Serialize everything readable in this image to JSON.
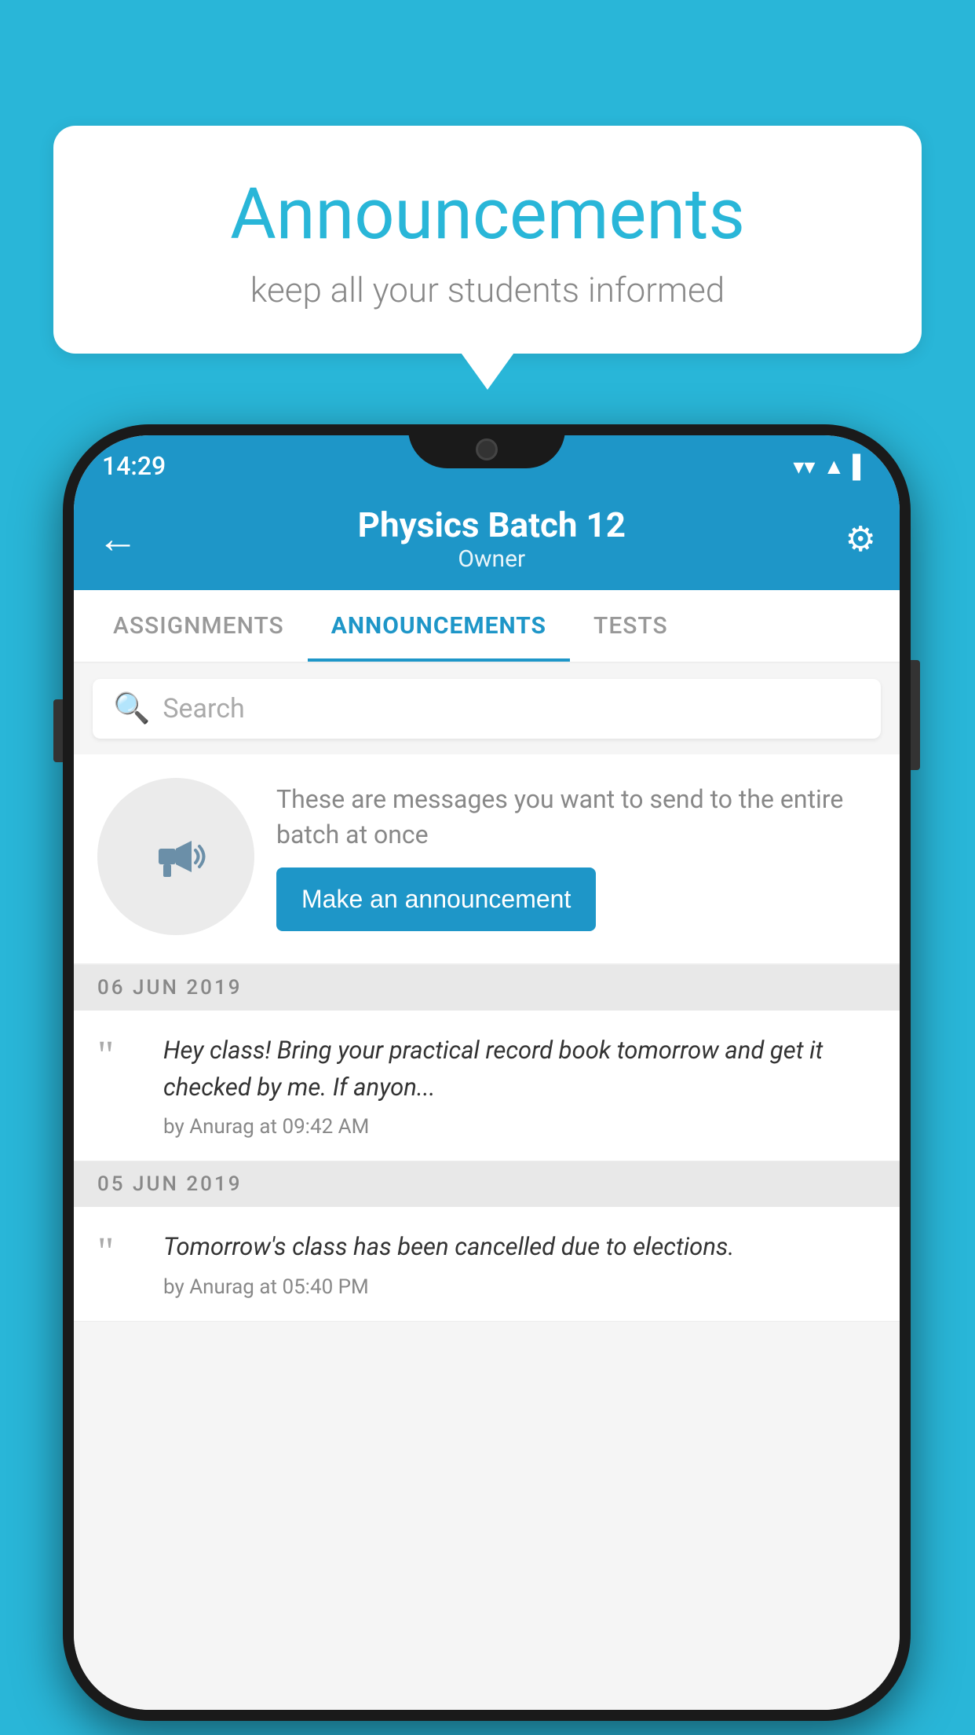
{
  "background_color": "#29b6d8",
  "speech_bubble": {
    "title": "Announcements",
    "subtitle": "keep all your students informed"
  },
  "phone": {
    "status_bar": {
      "time": "14:29",
      "icons": [
        "wifi",
        "signal",
        "battery"
      ]
    },
    "header": {
      "title": "Physics Batch 12",
      "subtitle": "Owner",
      "back_label": "←",
      "settings_label": "⚙"
    },
    "tabs": [
      {
        "label": "ASSIGNMENTS",
        "active": false
      },
      {
        "label": "ANNOUNCEMENTS",
        "active": true
      },
      {
        "label": "TESTS",
        "active": false
      }
    ],
    "search": {
      "placeholder": "Search"
    },
    "announcement_prompt": {
      "description": "These are messages you want to send to the entire batch at once",
      "button_label": "Make an announcement"
    },
    "announcements": [
      {
        "date": "06  JUN  2019",
        "text": "Hey class! Bring your practical record book tomorrow and get it checked by me. If anyon...",
        "meta": "by Anurag at 09:42 AM"
      },
      {
        "date": "05  JUN  2019",
        "text": "Tomorrow's class has been cancelled due to elections.",
        "meta": "by Anurag at 05:40 PM"
      }
    ]
  }
}
